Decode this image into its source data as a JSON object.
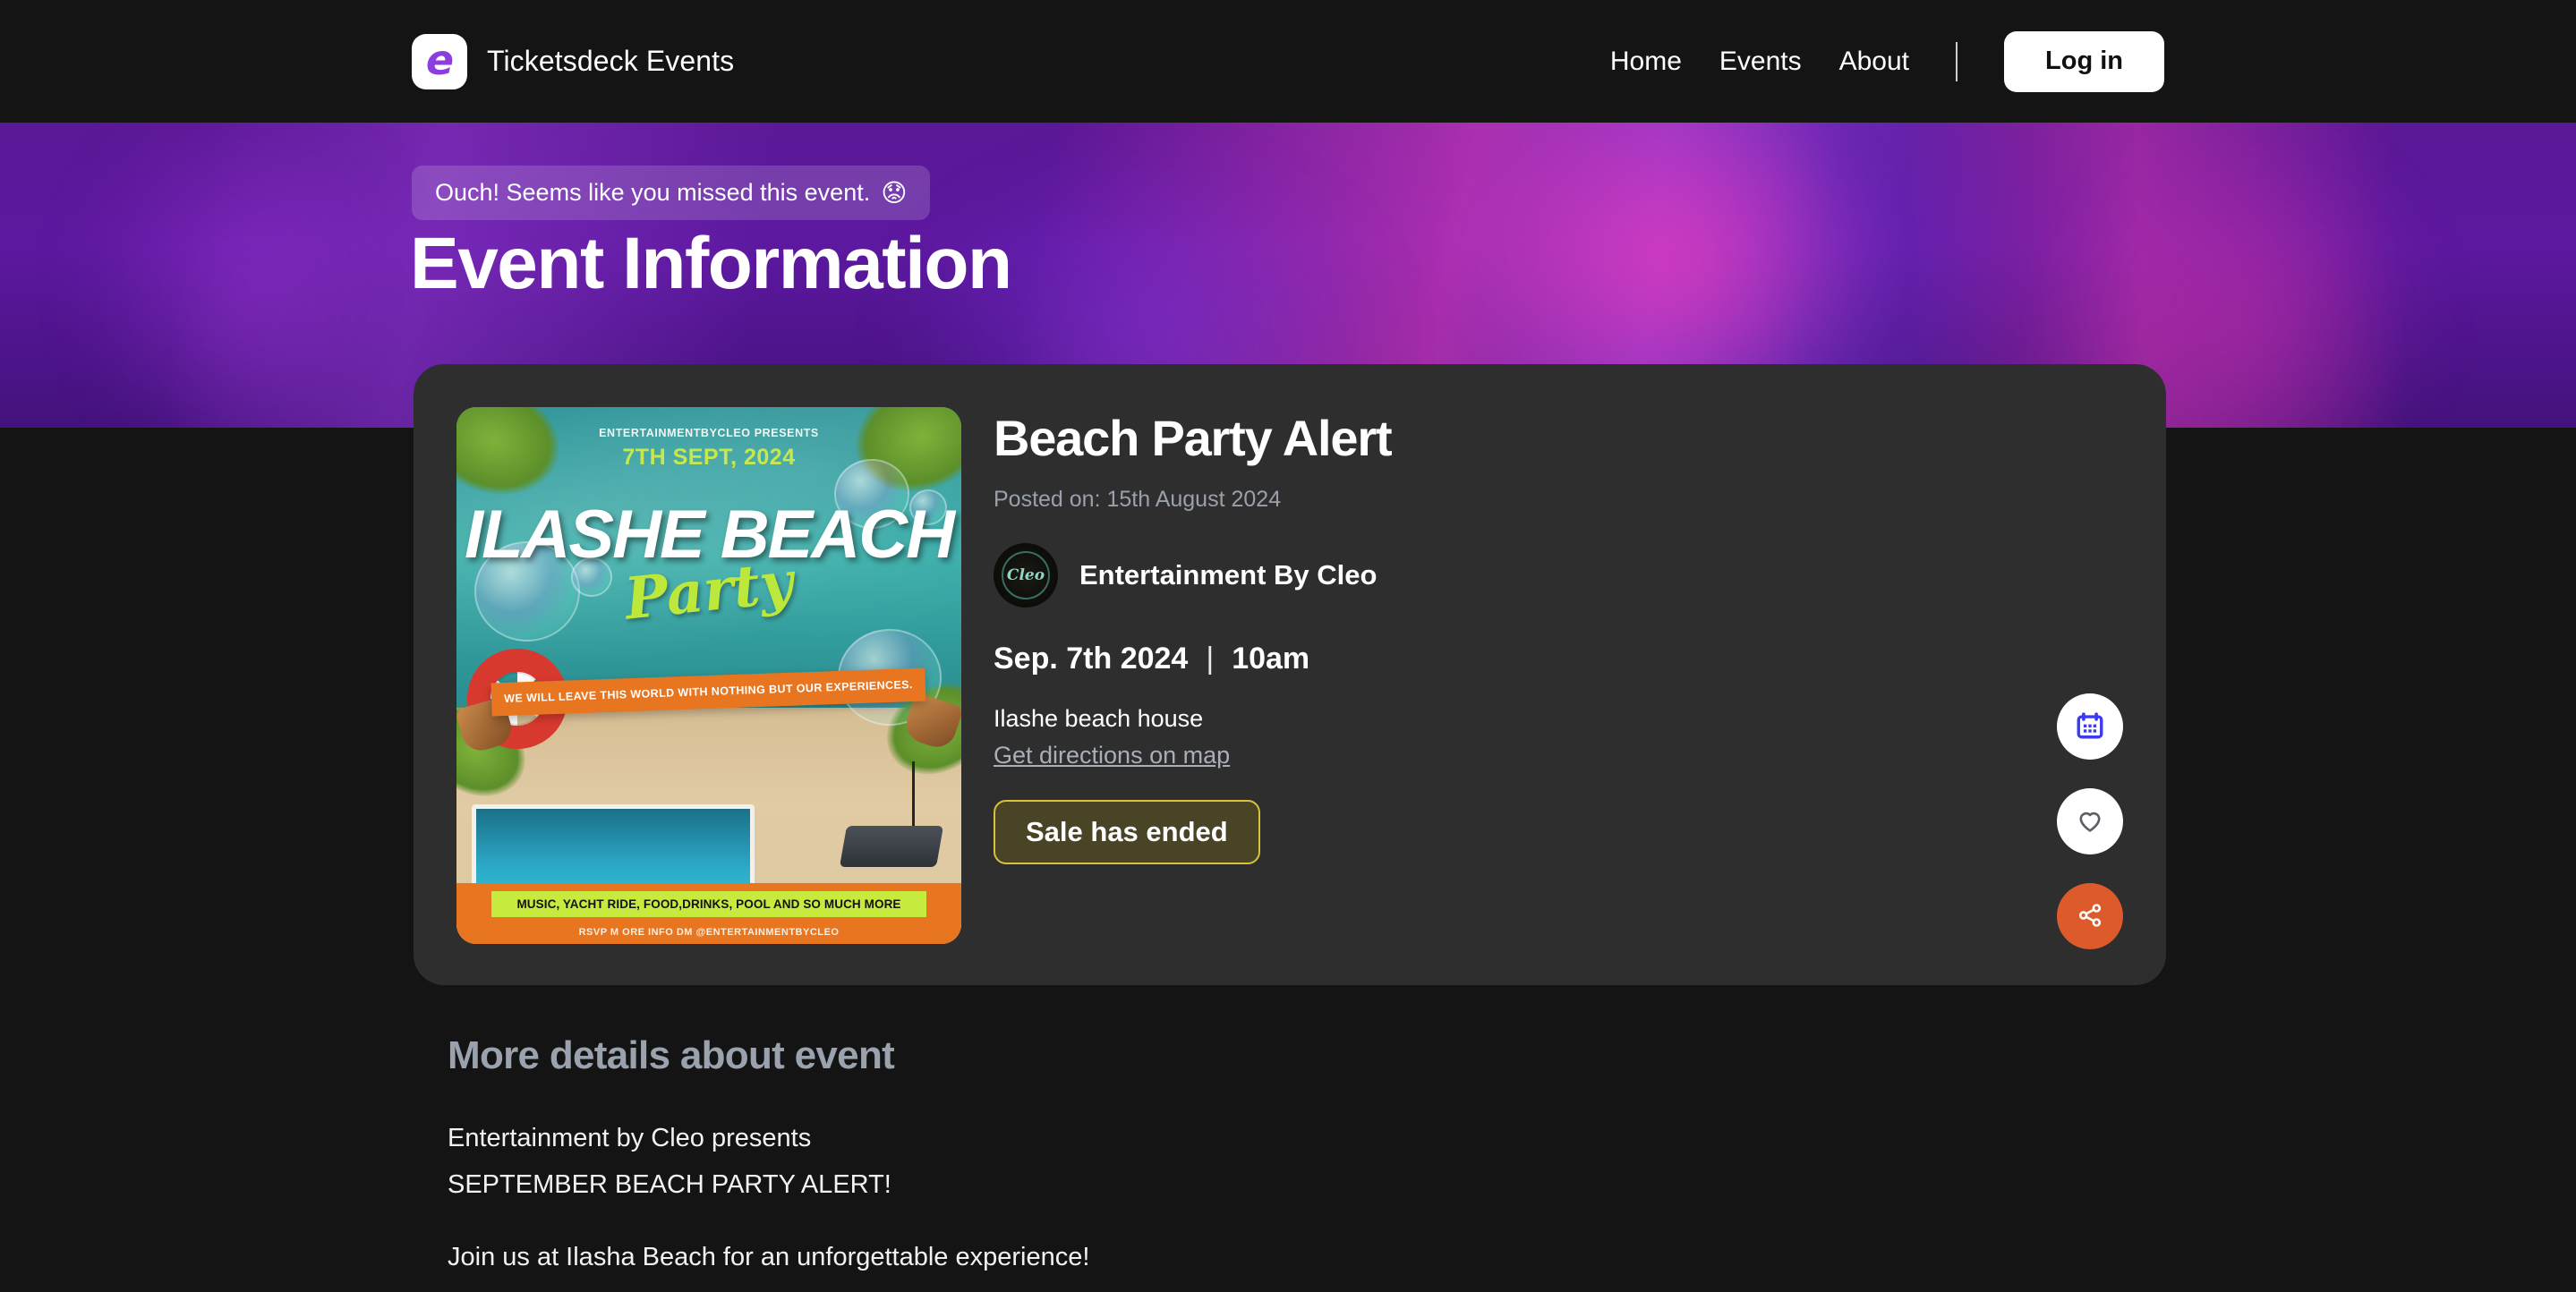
{
  "navbar": {
    "logo_icon": "ticketsdeck-e-logo-icon",
    "brand_name": "Ticketsdeck Events",
    "links": [
      {
        "label": "Home"
      },
      {
        "label": "Events"
      },
      {
        "label": "About"
      }
    ],
    "login_label": "Log in"
  },
  "hero": {
    "missed_banner": "Ouch! Seems like you missed this event.",
    "missed_emoji": "😟",
    "title": "Event Information"
  },
  "event": {
    "title": "Beach Party Alert",
    "posted_on": "Posted on: 15th August 2024",
    "organizer": "Entertainment By Cleo",
    "organizer_avatar_mark": "Cleo",
    "date": "Sep. 7th 2024",
    "separator": "|",
    "time": "10am",
    "venue": "Ilashe beach house",
    "directions_label": "Get directions on map",
    "sale_status_label": "Sale has ended",
    "flyer": {
      "presents": "ENTERTAINMENTBYCLEO PRESENTS",
      "date": "7TH SEPT, 2024",
      "headline": "ILASHE BEACH",
      "script_word": "Party",
      "slogan": "WE WILL LEAVE THIS WORLD WITH NOTHING BUT OUR EXPERIENCES.",
      "lime_bar": "MUSIC, YACHT RIDE, FOOD,DRINKS, POOL AND SO MUCH MORE",
      "rsvp": "RSVP M ORE INFO DM @ENTERTAINMENTBYCLEO"
    }
  },
  "actions": {
    "calendar_icon": "calendar-icon",
    "like_icon": "heart-icon",
    "share_icon": "share-icon"
  },
  "details": {
    "heading": "More details about event",
    "line1": "Entertainment by Cleo presents",
    "line2": "SEPTEMBER BEACH PARTY ALERT!",
    "line3": "Join us at Ilasha Beach for an unforgettable experience!"
  },
  "colors": {
    "page_background": "#141414",
    "card_background": "#2e2e2e",
    "hero_purple": "#5b1896",
    "hero_magenta": "#e83cba",
    "brand_purple": "#8b3ddd",
    "accent_orange": "#dd5a2a",
    "calendar_blue": "#3b3bf0",
    "sale_border_yellow": "#d8c23a",
    "muted_text": "#9aa0ab"
  }
}
